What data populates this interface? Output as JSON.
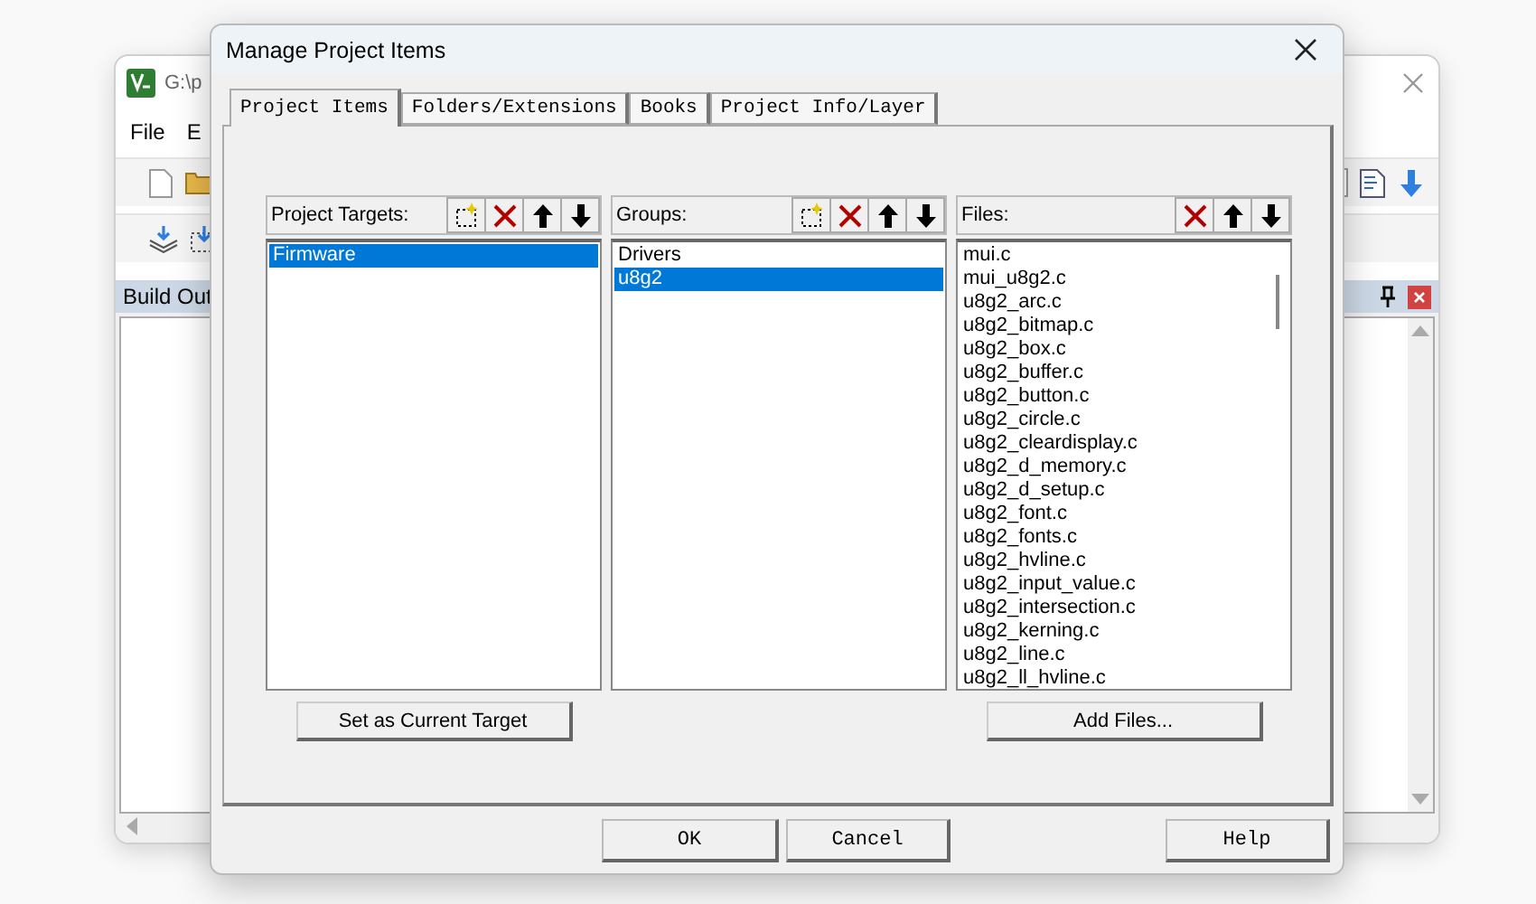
{
  "background_window": {
    "title": "G:\\p",
    "menu": [
      "File",
      "E"
    ],
    "output_panel": {
      "title": "Build Out"
    }
  },
  "dialog": {
    "title": "Manage Project Items",
    "tabs": [
      {
        "label": "Project Items",
        "selected": true
      },
      {
        "label": "Folders/Extensions",
        "selected": false
      },
      {
        "label": "Books",
        "selected": false
      },
      {
        "label": "Project Info/Layer",
        "selected": false
      }
    ],
    "panels": [
      {
        "label": "Project Targets:",
        "tools": [
          {
            "kind": "new"
          },
          {
            "kind": "delete"
          },
          {
            "kind": "up"
          },
          {
            "kind": "down"
          }
        ],
        "scrollbar": false,
        "items": [
          {
            "text": "Firmware",
            "selected": true
          }
        ]
      },
      {
        "label": "Groups:",
        "tools": [
          {
            "kind": "new"
          },
          {
            "kind": "delete"
          },
          {
            "kind": "up"
          },
          {
            "kind": "down"
          }
        ],
        "scrollbar": false,
        "items": [
          {
            "text": "Drivers",
            "selected": false
          },
          {
            "text": "u8g2",
            "selected": true
          }
        ]
      },
      {
        "label": "Files:",
        "tools": [
          {
            "kind": "delete"
          },
          {
            "kind": "up"
          },
          {
            "kind": "down"
          }
        ],
        "scrollbar": true,
        "items": [
          {
            "text": "mui.c",
            "selected": false
          },
          {
            "text": "mui_u8g2.c",
            "selected": false
          },
          {
            "text": "u8g2_arc.c",
            "selected": false
          },
          {
            "text": "u8g2_bitmap.c",
            "selected": false
          },
          {
            "text": "u8g2_box.c",
            "selected": false
          },
          {
            "text": "u8g2_buffer.c",
            "selected": false
          },
          {
            "text": "u8g2_button.c",
            "selected": false
          },
          {
            "text": "u8g2_circle.c",
            "selected": false
          },
          {
            "text": "u8g2_cleardisplay.c",
            "selected": false
          },
          {
            "text": "u8g2_d_memory.c",
            "selected": false
          },
          {
            "text": "u8g2_d_setup.c",
            "selected": false
          },
          {
            "text": "u8g2_font.c",
            "selected": false
          },
          {
            "text": "u8g2_fonts.c",
            "selected": false
          },
          {
            "text": "u8g2_hvline.c",
            "selected": false
          },
          {
            "text": "u8g2_input_value.c",
            "selected": false
          },
          {
            "text": "u8g2_intersection.c",
            "selected": false
          },
          {
            "text": "u8g2_kerning.c",
            "selected": false
          },
          {
            "text": "u8g2_line.c",
            "selected": false
          },
          {
            "text": "u8g2_ll_hvline.c",
            "selected": false
          }
        ]
      }
    ],
    "panel_buttons": [
      {
        "label": "Set as Current Target",
        "kind": "set_target"
      },
      {
        "label": "Add Files...",
        "kind": "add_files"
      }
    ],
    "buttons": [
      {
        "label": "OK",
        "kind": "ok"
      },
      {
        "label": "Cancel",
        "kind": "cancel"
      },
      {
        "label": "Help",
        "kind": "help"
      }
    ]
  }
}
